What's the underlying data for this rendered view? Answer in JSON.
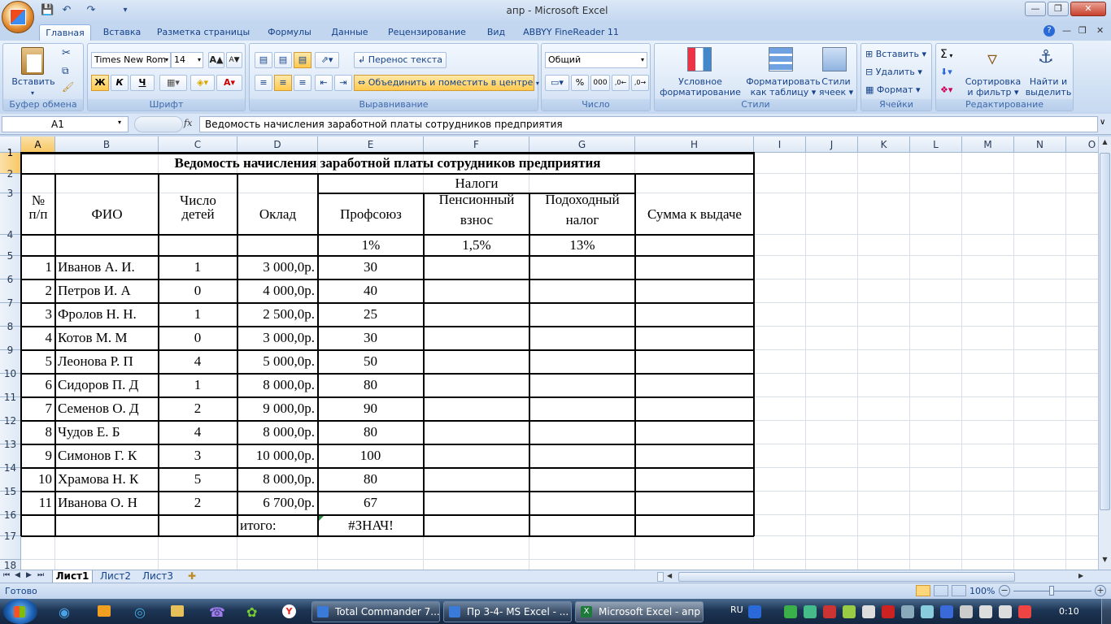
{
  "window": {
    "title": "апр - Microsoft Excel"
  },
  "ribbon_tabs": [
    "Главная",
    "Вставка",
    "Разметка страницы",
    "Формулы",
    "Данные",
    "Рецензирование",
    "Вид",
    "ABBYY FineReader 11"
  ],
  "clipboard": {
    "paste": "Вставить",
    "group": "Буфер обмена"
  },
  "font": {
    "name": "Times New Rom",
    "size": "14",
    "group": "Шрифт",
    "bold": "Ж",
    "italic": "К",
    "underline": "Ч"
  },
  "alignment": {
    "wrap": "Перенос текста",
    "merge": "Объединить и поместить в центре",
    "group": "Выравнивание"
  },
  "number": {
    "format": "Общий",
    "group": "Число",
    "percent": "%",
    "thousands": "000"
  },
  "styles": {
    "cond1": "Условное",
    "cond2": "форматирование",
    "table1": "Форматировать",
    "table2": "как таблицу",
    "cell1": "Стили",
    "cell2": "ячеек",
    "group": "Стили"
  },
  "cells": {
    "insert": "Вставить",
    "delete": "Удалить",
    "format": "Формат",
    "group": "Ячейки"
  },
  "editing": {
    "sigma": "Σ",
    "sort1": "Сортировка",
    "sort2": "и фильтр",
    "find1": "Найти и",
    "find2": "выделить",
    "group": "Редактирование"
  },
  "formula_bar": {
    "name_box": "A1",
    "fx": "fx",
    "content": "Ведомость начисления заработной платы сотрудников предприятия"
  },
  "columns": [
    "A",
    "B",
    "C",
    "D",
    "E",
    "F",
    "G",
    "H",
    "I",
    "J",
    "K",
    "L",
    "M",
    "N",
    "O"
  ],
  "rows": [
    "1",
    "2",
    "3",
    "4",
    "5",
    "6",
    "7",
    "8",
    "9",
    "10",
    "11",
    "12",
    "13",
    "14",
    "15",
    "16",
    "17",
    "18"
  ],
  "table": {
    "title": "Ведомость начисления заработной платы сотрудников предприятия",
    "h_num1": "№",
    "h_num2": "п/п",
    "h_fio": "ФИО",
    "h_kids1": "Число",
    "h_kids2": "детей",
    "h_salary": "Оклад",
    "h_taxes": "Налоги",
    "h_union": "Профсоюз",
    "h_pension1": "Пенсионный",
    "h_pension2": "взнос",
    "h_income1": "Подоходный",
    "h_income2": "налог",
    "h_total": "Сумма к выдаче",
    "rate_union": "1%",
    "rate_pension": "1,5%",
    "rate_income": "13%",
    "rows": [
      {
        "n": "1",
        "fio": "Иванов А. И.",
        "kids": "1",
        "salary": "3 000,0р.",
        "union": "30"
      },
      {
        "n": "2",
        "fio": "Петров И. А",
        "kids": "0",
        "salary": "4 000,0р.",
        "union": "40"
      },
      {
        "n": "3",
        "fio": "Фролов Н. Н.",
        "kids": "1",
        "salary": "2 500,0р.",
        "union": "25"
      },
      {
        "n": "4",
        "fio": "Котов М. М",
        "kids": "0",
        "salary": "3 000,0р.",
        "union": "30"
      },
      {
        "n": "5",
        "fio": "Леонова Р. П",
        "kids": "4",
        "salary": "5 000,0р.",
        "union": "50"
      },
      {
        "n": "6",
        "fio": "Сидоров П. Д",
        "kids": "1",
        "salary": "8 000,0р.",
        "union": "80"
      },
      {
        "n": "7",
        "fio": "Семенов О. Д",
        "kids": "2",
        "salary": "9 000,0р.",
        "union": "90"
      },
      {
        "n": "8",
        "fio": "Чудов Е. Б",
        "kids": "4",
        "salary": "8 000,0р.",
        "union": "80"
      },
      {
        "n": "9",
        "fio": "Симонов Г. К",
        "kids": "3",
        "salary": "10 000,0р.",
        "union": "100"
      },
      {
        "n": "10",
        "fio": "Храмова Н. К",
        "kids": "5",
        "salary": "8 000,0р.",
        "union": "80"
      },
      {
        "n": "11",
        "fio": "Иванова О. Н",
        "kids": "2",
        "salary": "6 700,0р.",
        "union": "67"
      }
    ],
    "total_label": "итого:",
    "total_value": "#ЗНАЧ!"
  },
  "sheets": [
    "Лист1",
    "Лист2",
    "Лист3"
  ],
  "status": {
    "ready": "Готово",
    "zoom": "100%"
  },
  "taskbar": {
    "items": [
      "Total Commander 7....",
      "Пр 3-4- MS Excel - ...",
      "Microsoft Excel - апр"
    ],
    "lang": "RU",
    "time": "0:10"
  }
}
